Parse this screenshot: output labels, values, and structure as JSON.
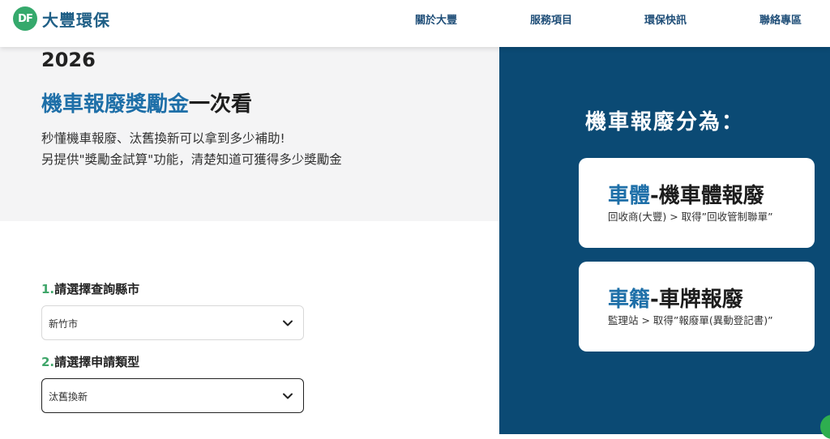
{
  "header": {
    "logo_badge": "DF",
    "logo_text": "大豐環保",
    "nav": [
      "關於大豐",
      "服務項目",
      "環保快訊",
      "聯絡專區"
    ]
  },
  "hero": {
    "year": "2026",
    "title_accent": "機車報廢獎勵金",
    "title_plain": "一次看",
    "desc_line1": "秒懂機車報廢、汰舊換新可以拿到多少補助!",
    "desc_line2": "另提供\"獎勵金試算\"功能，清楚知道可獲得多少獎勵金"
  },
  "form": {
    "step1_num": "1.",
    "step1_label": "請選擇查詢縣市",
    "step1_value": "新竹市",
    "step2_num": "2.",
    "step2_label": "請選擇申請類型",
    "step2_value": "汰舊換新"
  },
  "side": {
    "title": "機車報廢分為：",
    "cards": [
      {
        "accent": "車體",
        "plain": "-機車體報廢",
        "sub": "回收商(大豐) > 取得”回收管制聯單”"
      },
      {
        "accent": "車籍",
        "plain": "-車牌報廢",
        "sub": "監理站 > 取得”報廢單(異動登記書)”"
      }
    ]
  },
  "colors": {
    "accent_blue": "#1e6fa8",
    "side_bg": "#0b4a74",
    "step_green": "#3fa66a",
    "logo_green": "#35a96c"
  }
}
